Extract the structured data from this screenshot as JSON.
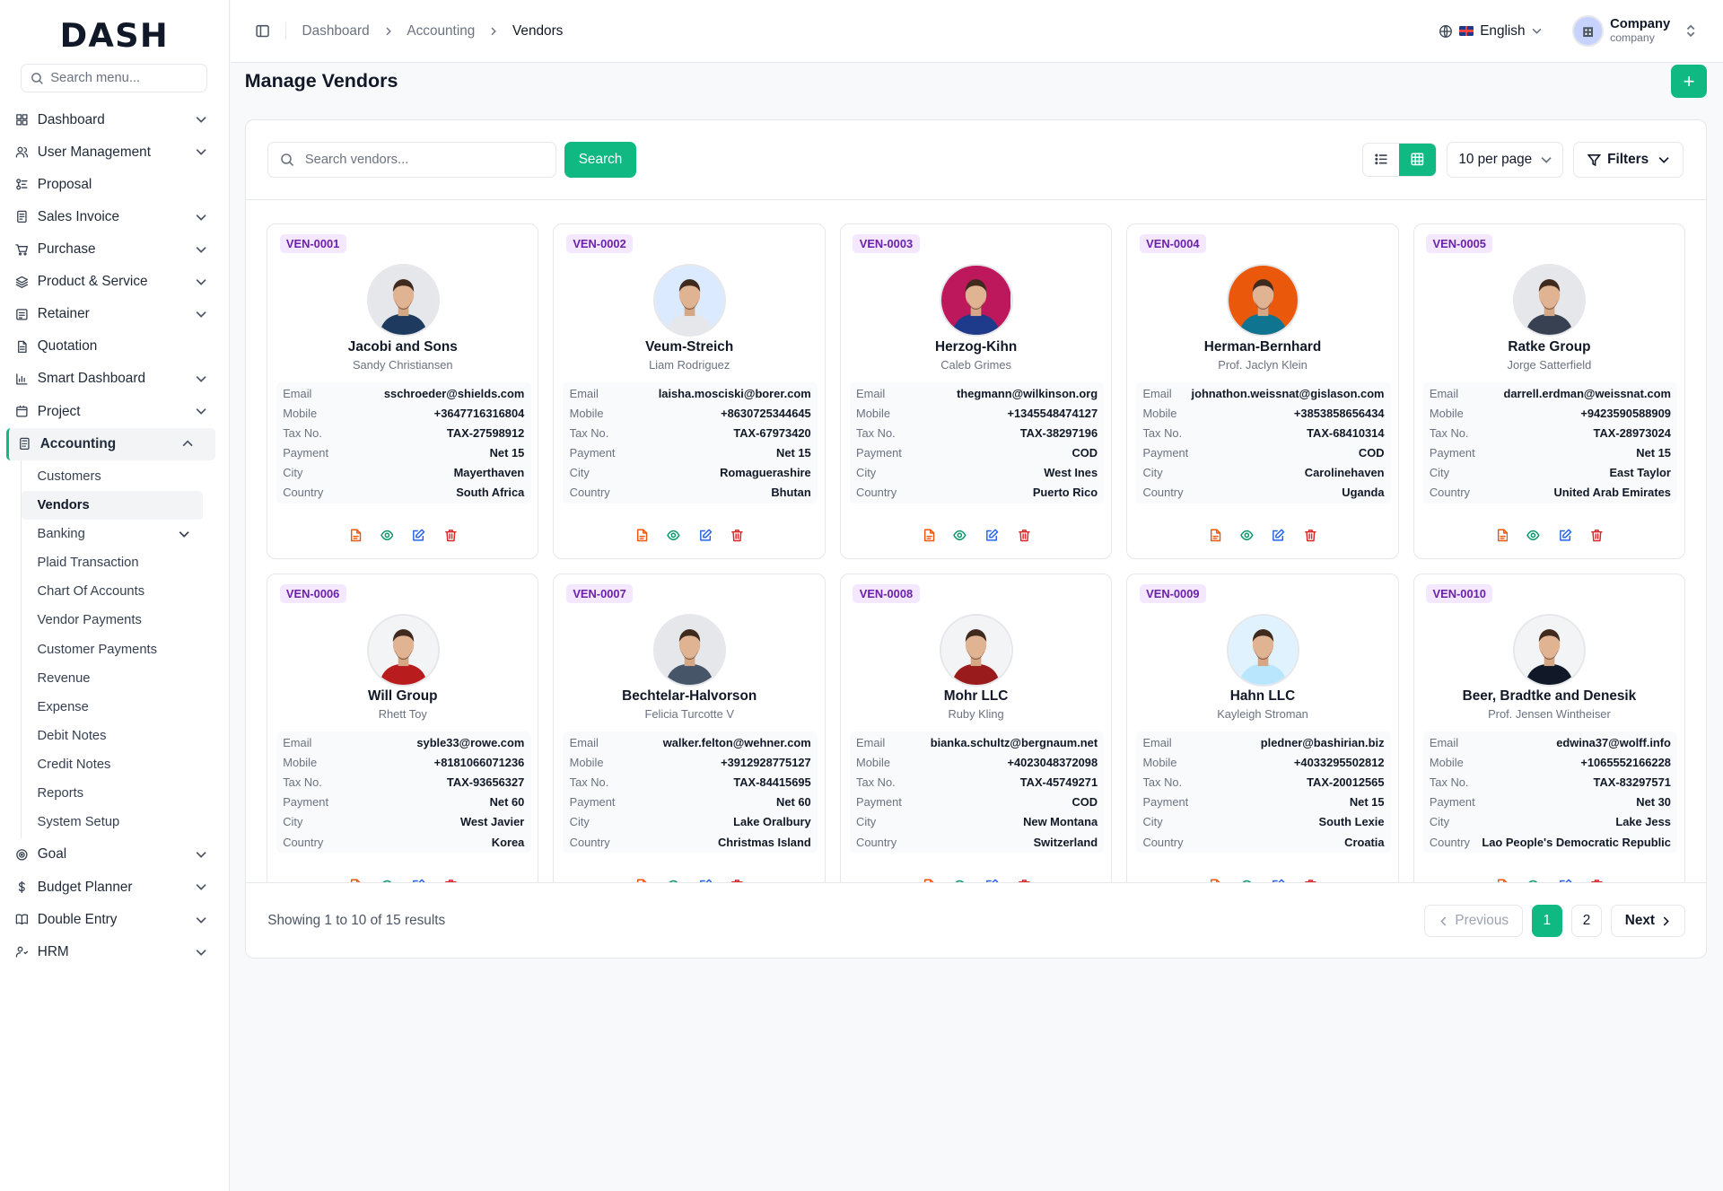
{
  "brand": {
    "logo_text": "DASH"
  },
  "sidebar": {
    "search_placeholder": "Search menu...",
    "items": [
      {
        "label": "Dashboard",
        "icon": "grid-icon",
        "chevron": true
      },
      {
        "label": "User Management",
        "icon": "users-icon",
        "chevron": true
      },
      {
        "label": "Proposal",
        "icon": "proposal-icon",
        "chevron": false
      },
      {
        "label": "Sales Invoice",
        "icon": "invoice-icon",
        "chevron": true
      },
      {
        "label": "Purchase",
        "icon": "cart-icon",
        "chevron": true
      },
      {
        "label": "Product & Service",
        "icon": "layers-icon",
        "chevron": true
      },
      {
        "label": "Retainer",
        "icon": "retainer-icon",
        "chevron": true
      },
      {
        "label": "Quotation",
        "icon": "quotation-icon",
        "chevron": false
      },
      {
        "label": "Smart Dashboard",
        "icon": "chart-icon",
        "chevron": true
      },
      {
        "label": "Project",
        "icon": "project-icon",
        "chevron": true
      },
      {
        "label": "Accounting",
        "icon": "calculator-icon",
        "chevron": true,
        "active": true
      }
    ],
    "accounting_sub": [
      {
        "label": "Customers"
      },
      {
        "label": "Vendors",
        "active": true
      },
      {
        "label": "Banking",
        "chevron": true
      },
      {
        "label": "Plaid Transaction"
      },
      {
        "label": "Chart Of Accounts"
      },
      {
        "label": "Vendor Payments"
      },
      {
        "label": "Customer Payments"
      },
      {
        "label": "Revenue"
      },
      {
        "label": "Expense"
      },
      {
        "label": "Debit Notes"
      },
      {
        "label": "Credit Notes"
      },
      {
        "label": "Reports"
      },
      {
        "label": "System Setup"
      }
    ],
    "items_after": [
      {
        "label": "Goal",
        "icon": "target-icon",
        "chevron": true
      },
      {
        "label": "Budget Planner",
        "icon": "dollar-icon",
        "chevron": true
      },
      {
        "label": "Double Entry",
        "icon": "book-icon",
        "chevron": true
      },
      {
        "label": "HRM",
        "icon": "hrm-icon",
        "chevron": true
      }
    ]
  },
  "topbar": {
    "breadcrumb": [
      "Dashboard",
      "Accounting",
      "Vendors"
    ],
    "language": "English",
    "company_name": "Company",
    "company_sub": "company"
  },
  "page": {
    "title": "Manage Vendors",
    "add_label": "+"
  },
  "toolbar": {
    "search_placeholder": "Search vendors...",
    "search_button": "Search",
    "per_page": "10 per page",
    "filters": "Filters"
  },
  "labels": {
    "email": "Email",
    "mobile": "Mobile",
    "tax": "Tax No.",
    "payment": "Payment",
    "city": "City",
    "country": "Country"
  },
  "colors": {
    "accent": "#10b981",
    "badge_bg": "#f3e8ff",
    "badge_text": "#6b21a8"
  },
  "vendors": [
    {
      "id": "VEN-0001",
      "name": "Jacobi and Sons",
      "contact": "Sandy Christiansen",
      "email": "sschroeder@shields.com",
      "mobile": "+3647716316804",
      "tax": "TAX-27598912",
      "payment": "Net 15",
      "city": "Mayerthaven",
      "country": "South Africa"
    },
    {
      "id": "VEN-0002",
      "name": "Veum-Streich",
      "contact": "Liam Rodriguez",
      "email": "laisha.mosciski@borer.com",
      "mobile": "+8630725344645",
      "tax": "TAX-67973420",
      "payment": "Net 15",
      "city": "Romaguerashire",
      "country": "Bhutan"
    },
    {
      "id": "VEN-0003",
      "name": "Herzog-Kihn",
      "contact": "Caleb Grimes",
      "email": "thegmann@wilkinson.org",
      "mobile": "+1345548474127",
      "tax": "TAX-38297196",
      "payment": "COD",
      "city": "West Ines",
      "country": "Puerto Rico"
    },
    {
      "id": "VEN-0004",
      "name": "Herman-Bernhard",
      "contact": "Prof. Jaclyn Klein",
      "email": "johnathon.weissnat@gislason.com",
      "mobile": "+3853858656434",
      "tax": "TAX-68410314",
      "payment": "COD",
      "city": "Carolinehaven",
      "country": "Uganda"
    },
    {
      "id": "VEN-0005",
      "name": "Ratke Group",
      "contact": "Jorge Satterfield",
      "email": "darrell.erdman@weissnat.com",
      "mobile": "+9423590588909",
      "tax": "TAX-28973024",
      "payment": "Net 15",
      "city": "East Taylor",
      "country": "United Arab Emirates"
    },
    {
      "id": "VEN-0006",
      "name": "Will Group",
      "contact": "Rhett Toy",
      "email": "syble33@rowe.com",
      "mobile": "+8181066071236",
      "tax": "TAX-93656327",
      "payment": "Net 60",
      "city": "West Javier",
      "country": "Korea"
    },
    {
      "id": "VEN-0007",
      "name": "Bechtelar-Halvorson",
      "contact": "Felicia Turcotte V",
      "email": "walker.felton@wehner.com",
      "mobile": "+3912928775127",
      "tax": "TAX-84415695",
      "payment": "Net 60",
      "city": "Lake Oralbury",
      "country": "Christmas Island"
    },
    {
      "id": "VEN-0008",
      "name": "Mohr LLC",
      "contact": "Ruby Kling",
      "email": "bianka.schultz@bergnaum.net",
      "mobile": "+4023048372098",
      "tax": "TAX-45749271",
      "payment": "COD",
      "city": "New Montana",
      "country": "Switzerland"
    },
    {
      "id": "VEN-0009",
      "name": "Hahn LLC",
      "contact": "Kayleigh Stroman",
      "email": "pledner@bashirian.biz",
      "mobile": "+4033295502812",
      "tax": "TAX-20012565",
      "payment": "Net 15",
      "city": "South Lexie",
      "country": "Croatia"
    },
    {
      "id": "VEN-0010",
      "name": "Beer, Bradtke and Denesik",
      "contact": "Prof. Jensen Wintheiser",
      "email": "edwina37@wolff.info",
      "mobile": "+1065552166228",
      "tax": "TAX-83297571",
      "payment": "Net 30",
      "city": "Lake Jess",
      "country": "Lao People's Democratic Republic"
    }
  ],
  "photo_palette": [
    {
      "bg": "#e5e7eb",
      "shirt": "#1f3a5f"
    },
    {
      "bg": "#dbeafe",
      "shirt": "#e5e7eb"
    },
    {
      "bg": "#be185d",
      "shirt": "#1e3a8a"
    },
    {
      "bg": "#ea580c",
      "shirt": "#0e7490"
    },
    {
      "bg": "#e5e7eb",
      "shirt": "#374151"
    },
    {
      "bg": "#f3f4f6",
      "shirt": "#b91c1c"
    },
    {
      "bg": "#e5e7eb",
      "shirt": "#475569"
    },
    {
      "bg": "#f3f4f6",
      "shirt": "#991b1b"
    },
    {
      "bg": "#e0f2fe",
      "shirt": "#bae6fd"
    },
    {
      "bg": "#f3f4f6",
      "shirt": "#111827"
    }
  ],
  "footer": {
    "showing": "Showing 1 to 10 of 15 results",
    "previous": "Previous",
    "pages": [
      "1",
      "2"
    ],
    "next": "Next"
  }
}
